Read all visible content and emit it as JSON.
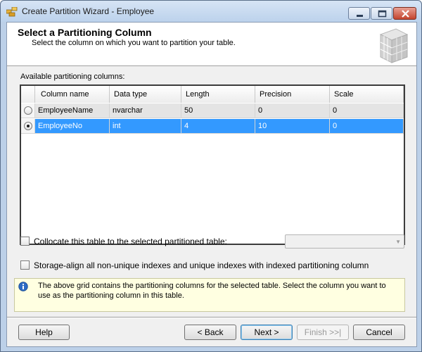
{
  "window": {
    "title": "Create Partition Wizard - Employee"
  },
  "header": {
    "title": "Select a Partitioning Column",
    "subtitle": "Select the column on which you want to partition your table."
  },
  "grid": {
    "label": "Available partitioning columns:",
    "columns": [
      "Column name",
      "Data type",
      "Length",
      "Precision",
      "Scale"
    ],
    "rows": [
      {
        "selected": false,
        "cells": [
          "EmployeeName",
          "nvarchar",
          "50",
          "0",
          "0"
        ]
      },
      {
        "selected": true,
        "cells": [
          "EmployeeNo",
          "int",
          "4",
          "10",
          "0"
        ]
      }
    ]
  },
  "options": {
    "collocate_label": "Collocate this table to the selected partitioned table:",
    "collocate_checked": false,
    "collocate_combo_value": "",
    "storage_align_label": "Storage-align all non-unique indexes and unique indexes with indexed partitioning column",
    "storage_align_checked": false
  },
  "info": {
    "icon": "info-icon",
    "text": "The above grid contains the partitioning columns for the selected table. Select the column you want to use as the partitioning column in this table."
  },
  "buttons": {
    "help": "Help",
    "back": "< Back",
    "next": "Next >",
    "finish": "Finish >>|",
    "cancel": "Cancel"
  },
  "colors": {
    "selection": "#3399ff",
    "info_background": "#ffffe1"
  }
}
